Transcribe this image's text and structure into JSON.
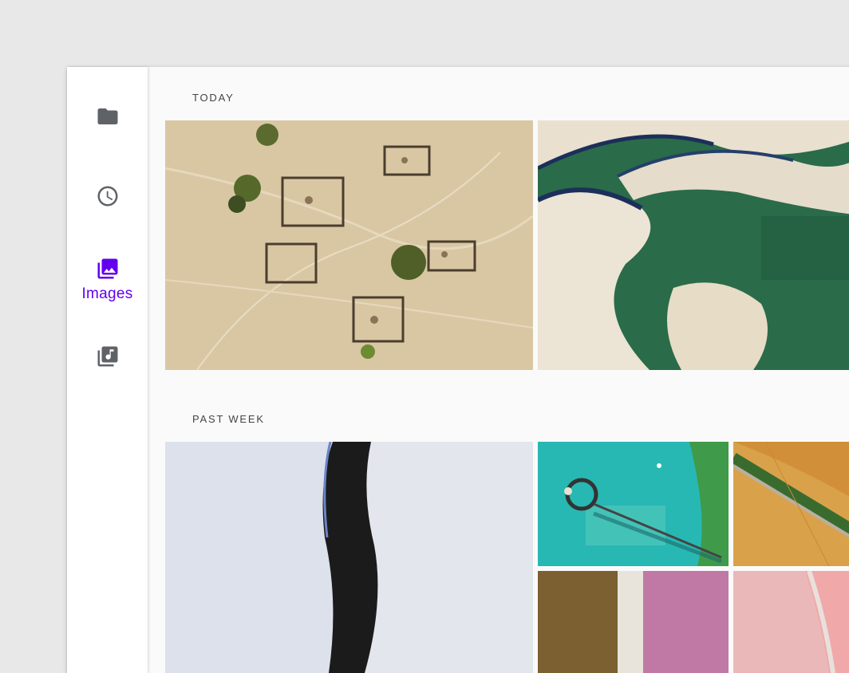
{
  "rail": {
    "items": [
      {
        "icon": "folder-icon",
        "label": "",
        "active": false
      },
      {
        "icon": "clock-icon",
        "label": "",
        "active": false
      },
      {
        "icon": "image-icon",
        "label": "Images",
        "active": true
      },
      {
        "icon": "music-library-icon",
        "label": "",
        "active": false
      }
    ],
    "active_color": "#6200ee",
    "inactive_color": "#5f6368"
  },
  "sections": [
    {
      "title": "TODAY",
      "photos": [
        "aerial-village",
        "sand-dunes-lagoons"
      ]
    },
    {
      "title": "PAST WEEK",
      "photos": [
        "salt-flat-river",
        "turquoise-pier",
        "wheat-fields-road",
        "brown-pink-salt-pond",
        "pink-salt-lake"
      ]
    }
  ]
}
